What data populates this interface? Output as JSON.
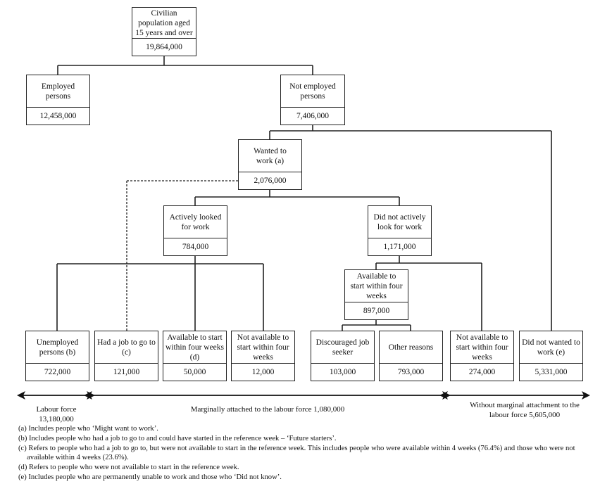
{
  "nodes": {
    "civilian": {
      "label": "Civilian population aged 15 years and over",
      "value": "19,864,000"
    },
    "employed": {
      "label": "Employed persons",
      "value": "12,458,000"
    },
    "not_employed": {
      "label": "Not employed persons",
      "value": "7,406,000"
    },
    "wanted": {
      "label": "Wanted to work (a)",
      "value": "2,076,000"
    },
    "actively": {
      "label": "Actively looked for work",
      "value": "784,000"
    },
    "not_actively": {
      "label": "Did not actively look for work",
      "value": "1,171,000"
    },
    "available_4wk": {
      "label": "Available to start within four weeks",
      "value": "897,000"
    },
    "unemployed": {
      "label": "Unemployed persons (b)",
      "value": "722,000"
    },
    "had_job": {
      "label": "Had a job to go to (c)",
      "value": "121,000"
    },
    "avail_d": {
      "label": "Available to start within four weeks (d)",
      "value": "50,000"
    },
    "not_avail_a": {
      "label": "Not available to start within four weeks",
      "value": "12,000"
    },
    "discouraged": {
      "label": "Discouraged job seeker",
      "value": "103,000"
    },
    "other": {
      "label": "Other reasons",
      "value": "793,000"
    },
    "not_avail_b": {
      "label": "Not available to start within four weeks",
      "value": "274,000"
    },
    "did_not_want": {
      "label": "Did not wanted to work (e)",
      "value": "5,331,000"
    }
  },
  "ranges": {
    "labour_force": {
      "label": "Labour force",
      "value": "13,180,000"
    },
    "marginal": {
      "label": "Marginally attached to the labour force  1,080,000"
    },
    "without": {
      "label": "Without marginal attachment to the labour force  5,605,000"
    }
  },
  "notes": [
    "(a) Includes people who ‘Might want to work’.",
    "(b) Includes people who had a job to go to and could have started in the reference week – ‘Future starters’.",
    "(c) Refers to people who had a job to go to, but were not available to start in the reference week. This includes people who were available within 4 weeks (76.4%) and those who were not available within 4 weeks (23.6%).",
    "(d) Refers to people who were not available to start in the reference week.",
    "(e) Includes people who are permanently unable to work and those who ‘Did not know’."
  ]
}
